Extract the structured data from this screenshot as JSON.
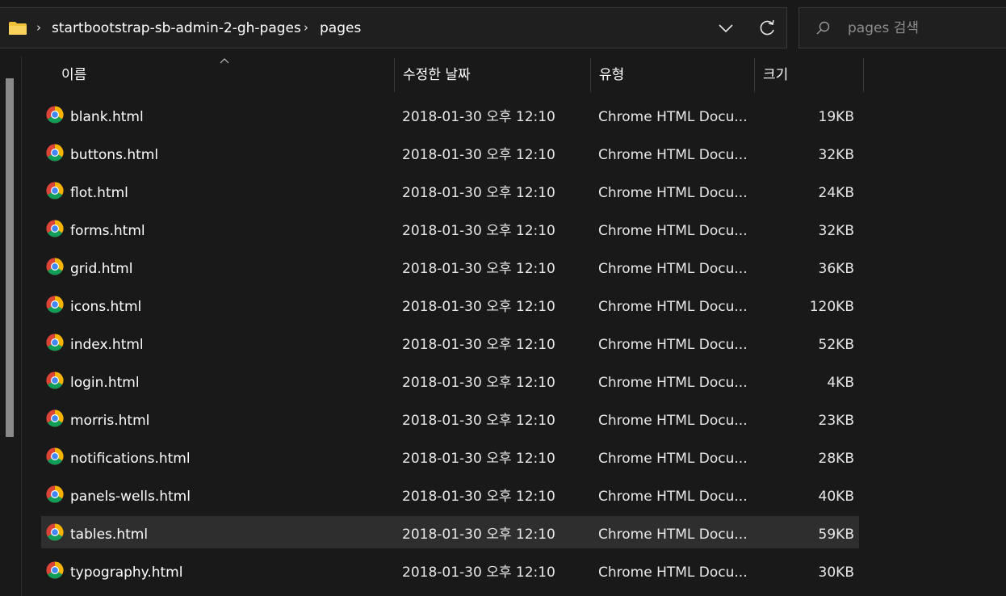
{
  "breadcrumb": {
    "items": [
      "startbootstrap-sb-admin-2-gh-pages",
      "pages"
    ]
  },
  "search": {
    "placeholder": "pages 검색"
  },
  "columns": {
    "name": "이름",
    "date": "수정한 날짜",
    "type": "유형",
    "size": "크기"
  },
  "files": [
    {
      "name": "blank.html",
      "date": "2018-01-30 오후 12:10",
      "type": "Chrome HTML Docu...",
      "size": "19KB"
    },
    {
      "name": "buttons.html",
      "date": "2018-01-30 오후 12:10",
      "type": "Chrome HTML Docu...",
      "size": "32KB"
    },
    {
      "name": "flot.html",
      "date": "2018-01-30 오후 12:10",
      "type": "Chrome HTML Docu...",
      "size": "24KB"
    },
    {
      "name": "forms.html",
      "date": "2018-01-30 오후 12:10",
      "type": "Chrome HTML Docu...",
      "size": "32KB"
    },
    {
      "name": "grid.html",
      "date": "2018-01-30 오후 12:10",
      "type": "Chrome HTML Docu...",
      "size": "36KB"
    },
    {
      "name": "icons.html",
      "date": "2018-01-30 오후 12:10",
      "type": "Chrome HTML Docu...",
      "size": "120KB"
    },
    {
      "name": "index.html",
      "date": "2018-01-30 오후 12:10",
      "type": "Chrome HTML Docu...",
      "size": "52KB"
    },
    {
      "name": "login.html",
      "date": "2018-01-30 오후 12:10",
      "type": "Chrome HTML Docu...",
      "size": "4KB"
    },
    {
      "name": "morris.html",
      "date": "2018-01-30 오후 12:10",
      "type": "Chrome HTML Docu...",
      "size": "23KB"
    },
    {
      "name": "notifications.html",
      "date": "2018-01-30 오후 12:10",
      "type": "Chrome HTML Docu...",
      "size": "28KB"
    },
    {
      "name": "panels-wells.html",
      "date": "2018-01-30 오후 12:10",
      "type": "Chrome HTML Docu...",
      "size": "40KB"
    },
    {
      "name": "tables.html",
      "date": "2018-01-30 오후 12:10",
      "type": "Chrome HTML Docu...",
      "size": "59KB",
      "selected": true
    },
    {
      "name": "typography.html",
      "date": "2018-01-30 오후 12:10",
      "type": "Chrome HTML Docu...",
      "size": "30KB"
    }
  ],
  "icons": {
    "folder": "folder-icon",
    "file": "chrome-html-icon",
    "search": "search-icon",
    "refresh": "refresh-icon",
    "dropdown": "chevron-down-icon",
    "sort": "sort-up-icon",
    "crumb_separator": "chevron-right-icon"
  },
  "colors": {
    "background": "#191919",
    "selected_row": "#2e2e2e",
    "folder": "#f2c13a"
  }
}
